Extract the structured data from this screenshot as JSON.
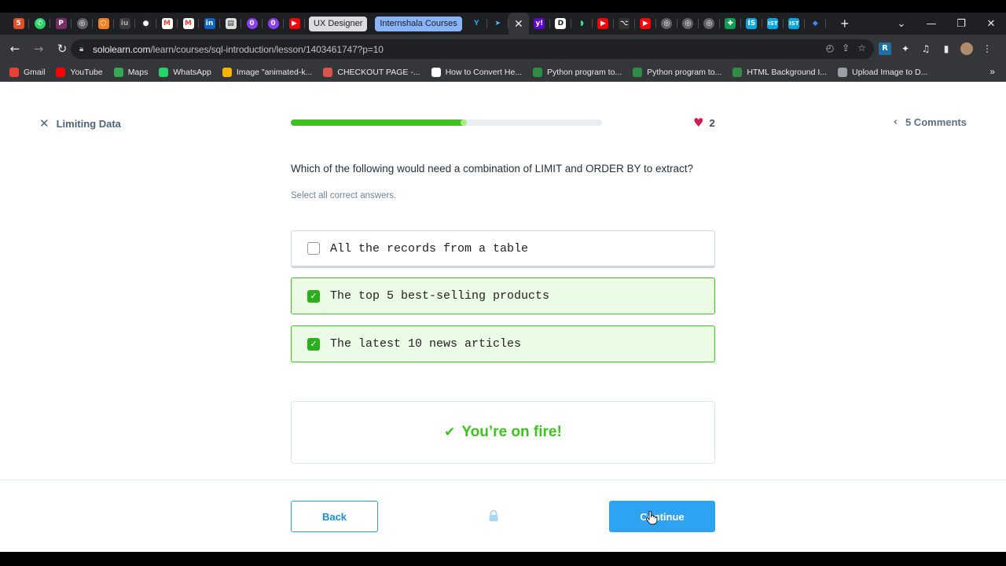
{
  "browser": {
    "tab_groups": [
      "UX Designer",
      "Internshala Courses"
    ],
    "url_host": "sololearn.com",
    "url_path": "/learn/courses/sql-introduction/lesson/1403461747?p=10",
    "bookmarks": [
      {
        "label": "Gmail",
        "color": "#ea4335"
      },
      {
        "label": "YouTube",
        "color": "#ff0000"
      },
      {
        "label": "Maps",
        "color": "#34a853"
      },
      {
        "label": "WhatsApp",
        "color": "#25d366"
      },
      {
        "label": "Image \"animated-k...",
        "color": "#f4b400"
      },
      {
        "label": "CHECKOUT PAGE -...",
        "color": "#d9534f"
      },
      {
        "label": "How to Convert He...",
        "color": "#ffffff"
      },
      {
        "label": "Python program to...",
        "color": "#2f8d46"
      },
      {
        "label": "Python program to...",
        "color": "#2f8d46"
      },
      {
        "label": "HTML Background I...",
        "color": "#2f8d46"
      },
      {
        "label": "Upload Image to D...",
        "color": "#9aa0a6"
      }
    ]
  },
  "lesson": {
    "title": "Limiting Data",
    "progress_fraction": 0.56,
    "lives": "2",
    "comments": "5 Comments"
  },
  "question": {
    "text": "Which of the following would need a combination of LIMIT and ORDER BY to extract?",
    "hint": "Select all correct answers.",
    "options": [
      {
        "label": "All the records from a table",
        "selected": false
      },
      {
        "label": "The top 5 best-selling products",
        "selected": true
      },
      {
        "label": "The latest 10 news articles",
        "selected": true
      }
    ]
  },
  "feedback": "You’re on fire!",
  "footer": {
    "back_label": "Back",
    "continue_label": "Continue"
  },
  "colors": {
    "accent_green": "#3dc220",
    "accent_blue": "#2ea3f2",
    "heart": "#d01b57"
  }
}
